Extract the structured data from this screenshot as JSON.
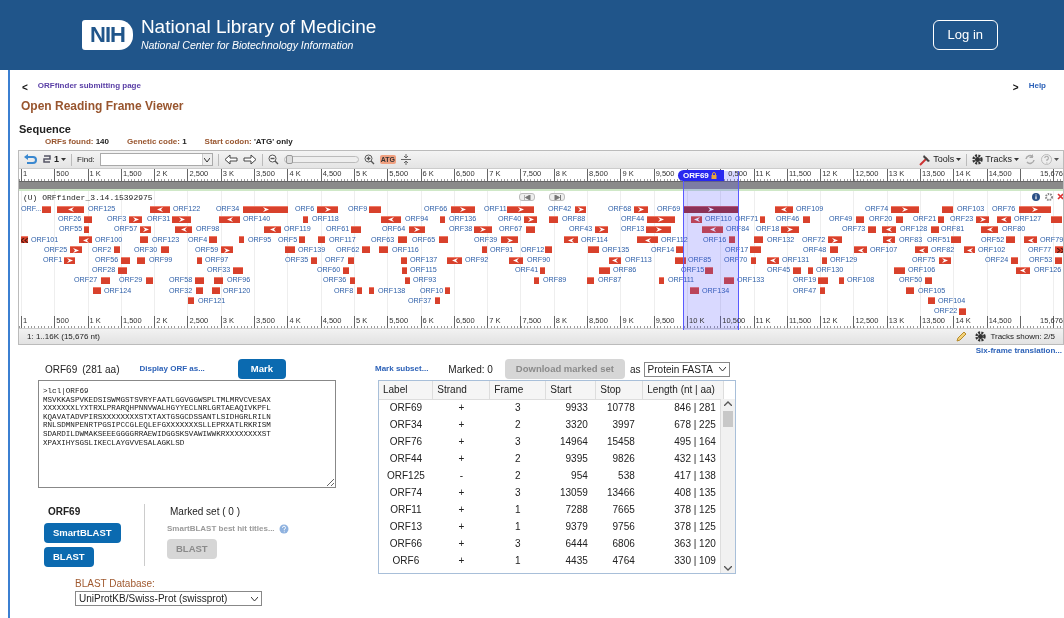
{
  "header": {
    "logo": "NIH",
    "title": "National Library of Medicine",
    "subtitle": "National Center for Biotechnology Information",
    "login": "Log in"
  },
  "nav": {
    "back_arrow": "<",
    "back_link": "ORFfinder submitting page",
    "help_arrow": ">",
    "help": "Help"
  },
  "heading": "Open Reading Frame Viewer",
  "section": "Sequence",
  "stats": [
    {
      "label": "ORFs found:",
      "value": "140"
    },
    {
      "label": "Genetic code:",
      "value": "1"
    },
    {
      "label": "Start codon:",
      "value": "'ATG' only"
    }
  ],
  "viewer": {
    "toolbar": {
      "layout_count": "1",
      "find_label": "Find:",
      "atg": "ATG",
      "tools": "Tools",
      "tracks": "Tracks"
    },
    "top_ruler": [
      "1",
      "500",
      "1 K",
      "1,500",
      "2 K",
      "2,500",
      "3 K",
      "3,500",
      "4 K",
      "4,500",
      "5 K",
      "5,500",
      "6 K",
      "6,500",
      "7 K",
      "7,500",
      "8 K",
      "8,500",
      "9 K",
      "9,500",
      "0,500",
      "11 K",
      "11,500",
      "12 K",
      "12,500",
      "13 K",
      "13,500",
      "14 K",
      "14,500",
      "15,676"
    ],
    "marker": "ORF69",
    "track_title": "(U) ORFfinder_3.14.15392975",
    "lanes": [
      {
        "features": [
          {
            "label": "ORF...",
            "kind": "plain",
            "selected": false
          },
          {
            "label": "ORF125",
            "kind": "left",
            "selected": false
          },
          {
            "label": "ORF122",
            "kind": "left",
            "selected": false
          },
          {
            "label": "ORF34",
            "kind": "right",
            "selected": false
          },
          {
            "label": "ORF6",
            "kind": "right",
            "selected": false
          },
          {
            "label": "ORF9",
            "kind": "plain",
            "selected": false
          },
          {
            "label": "ORF66",
            "kind": "right",
            "selected": false
          },
          {
            "label": "ORF11",
            "kind": "right",
            "selected": false
          },
          {
            "label": "ORF42",
            "kind": "right",
            "selected": false
          },
          {
            "label": "ORF68",
            "kind": "right",
            "selected": false
          },
          {
            "label": "ORF69",
            "kind": "right",
            "selected": true
          },
          {
            "label": "ORF109",
            "kind": "left",
            "selected": false
          },
          {
            "label": "ORF74",
            "kind": "right",
            "selected": false
          },
          {
            "label": "ORF103",
            "kind": "plain",
            "selected": false
          },
          {
            "label": "ORF76",
            "kind": "right",
            "selected": false
          }
        ]
      },
      {
        "features": [
          {
            "label": "ORF26",
            "kind": "plain",
            "selected": false
          },
          {
            "label": "ORF3",
            "kind": "right",
            "selected": false
          },
          {
            "label": "ORF31",
            "kind": "right",
            "selected": false
          },
          {
            "label": "ORF140",
            "kind": "left",
            "selected": false
          },
          {
            "label": "ORF118",
            "kind": "plain",
            "selected": false
          },
          {
            "label": "ORF94",
            "kind": "left",
            "selected": false
          },
          {
            "label": "ORF136",
            "kind": "plain",
            "selected": false
          },
          {
            "label": "ORF40",
            "kind": "right",
            "selected": false
          },
          {
            "label": "ORF88",
            "kind": "plain",
            "selected": false
          },
          {
            "label": "ORF44",
            "kind": "right",
            "selected": false
          },
          {
            "label": "ORF110",
            "kind": "left",
            "selected": false
          },
          {
            "label": "ORF71",
            "kind": "plain",
            "selected": false
          },
          {
            "label": "ORF46",
            "kind": "plain",
            "selected": false
          },
          {
            "label": "ORF49",
            "kind": "plain",
            "selected": false
          },
          {
            "label": "ORF20",
            "kind": "plain",
            "selected": false
          },
          {
            "label": "ORF21",
            "kind": "plain",
            "selected": false
          },
          {
            "label": "ORF23",
            "kind": "right",
            "selected": false
          },
          {
            "label": "ORF127",
            "kind": "left",
            "selected": false
          },
          {
            "kind": "plain",
            "selected": false
          }
        ]
      },
      {
        "features": [
          {
            "label": "ORF55",
            "kind": "plain",
            "selected": false
          },
          {
            "label": "ORF57",
            "kind": "right",
            "selected": false
          },
          {
            "label": "ORF98",
            "kind": "left",
            "selected": false
          },
          {
            "label": "ORF119",
            "kind": "left",
            "selected": false
          },
          {
            "label": "ORF61",
            "kind": "plain",
            "selected": false
          },
          {
            "label": "ORF64",
            "kind": "right",
            "selected": false
          },
          {
            "label": "ORF38",
            "kind": "right",
            "selected": false
          },
          {
            "label": "ORF67",
            "kind": "plain",
            "selected": false
          },
          {
            "label": "ORF43",
            "kind": "right",
            "selected": false
          },
          {
            "label": "ORF13",
            "kind": "right",
            "selected": false
          },
          {
            "label": "ORF84",
            "kind": "left",
            "selected": false
          },
          {
            "label": "ORF18",
            "kind": "right",
            "selected": false
          },
          {
            "label": "ORF73",
            "kind": "plain",
            "selected": false
          },
          {
            "label": "ORF128",
            "kind": "left",
            "selected": false
          },
          {
            "label": "ORF81",
            "kind": "plain",
            "selected": false
          },
          {
            "label": "ORF80",
            "kind": "left",
            "selected": false
          }
        ]
      },
      {
        "features": [
          {
            "label": "ORF101",
            "kind": "edge-left",
            "selected": false
          },
          {
            "label": "ORF100",
            "kind": "left",
            "selected": false
          },
          {
            "label": "ORF123",
            "kind": "plain",
            "selected": false
          },
          {
            "label": "ORF4",
            "kind": "plain",
            "selected": false
          },
          {
            "label": "ORF95",
            "kind": "plain",
            "selected": false
          },
          {
            "label": "ORF5",
            "kind": "plain",
            "selected": false
          },
          {
            "label": "ORF117",
            "kind": "plain",
            "selected": false
          },
          {
            "label": "ORF63",
            "kind": "plain",
            "selected": false
          },
          {
            "label": "ORF65",
            "kind": "plain",
            "selected": false
          },
          {
            "label": "ORF39",
            "kind": "right",
            "selected": false
          },
          {
            "label": "ORF114",
            "kind": "left",
            "selected": false
          },
          {
            "label": "ORF112",
            "kind": "left",
            "selected": false
          },
          {
            "label": "ORF16",
            "kind": "plain",
            "selected": false
          },
          {
            "label": "ORF132",
            "kind": "plain",
            "selected": false
          },
          {
            "label": "ORF72",
            "kind": "right",
            "selected": false
          },
          {
            "label": "ORF83",
            "kind": "left",
            "selected": false
          },
          {
            "label": "ORF51",
            "kind": "plain",
            "selected": false
          },
          {
            "label": "ORF52",
            "kind": "plain",
            "selected": false
          },
          {
            "label": "ORF79",
            "kind": "left",
            "selected": false
          }
        ]
      },
      {
        "features": [
          {
            "label": "ORF25",
            "kind": "right",
            "selected": false
          },
          {
            "label": "ORF2",
            "kind": "plain",
            "selected": false
          },
          {
            "label": "ORF30",
            "kind": "plain",
            "selected": false
          },
          {
            "label": "ORF59",
            "kind": "right",
            "selected": false
          },
          {
            "label": "ORF139",
            "kind": "plain",
            "selected": false
          },
          {
            "label": "ORF62",
            "kind": "plain",
            "selected": false
          },
          {
            "label": "ORF116",
            "kind": "plain",
            "selected": false
          },
          {
            "label": "ORF91",
            "kind": "plain",
            "selected": false
          },
          {
            "label": "ORF12",
            "kind": "plain",
            "selected": false
          },
          {
            "label": "ORF135",
            "kind": "plain",
            "selected": false
          },
          {
            "label": "ORF14",
            "kind": "plain",
            "selected": false
          },
          {
            "label": "ORF17",
            "kind": "plain",
            "selected": false
          },
          {
            "label": "ORF48",
            "kind": "plain",
            "selected": false
          },
          {
            "label": "ORF107",
            "kind": "left",
            "selected": false
          },
          {
            "label": "ORF82",
            "kind": "left",
            "selected": false
          },
          {
            "label": "ORF102",
            "kind": "left",
            "selected": false
          },
          {
            "label": "ORF77",
            "kind": "edge-right",
            "selected": false
          }
        ]
      },
      {
        "features": [
          {
            "label": "ORF1",
            "kind": "right",
            "selected": false
          },
          {
            "label": "ORF56",
            "kind": "plain",
            "selected": false
          },
          {
            "label": "ORF99",
            "kind": "plain",
            "selected": false
          },
          {
            "label": "ORF97",
            "kind": "plain",
            "selected": false
          },
          {
            "label": "ORF35",
            "kind": "plain",
            "selected": false
          },
          {
            "label": "ORF7",
            "kind": "plain",
            "selected": false
          },
          {
            "label": "ORF137",
            "kind": "plain",
            "selected": false
          },
          {
            "label": "ORF92",
            "kind": "left",
            "selected": false
          },
          {
            "label": "ORF90",
            "kind": "left",
            "selected": false
          },
          {
            "label": "ORF113",
            "kind": "left",
            "selected": false
          },
          {
            "label": "ORF85",
            "kind": "plain",
            "selected": false
          },
          {
            "label": "ORF70",
            "kind": "plain",
            "selected": false
          },
          {
            "label": "ORF131",
            "kind": "left",
            "selected": false
          },
          {
            "label": "ORF129",
            "kind": "plain",
            "selected": false
          },
          {
            "label": "ORF75",
            "kind": "right",
            "selected": false
          },
          {
            "label": "ORF24",
            "kind": "plain",
            "selected": false
          },
          {
            "label": "ORF53",
            "kind": "plain",
            "selected": false
          }
        ]
      },
      {
        "features": [
          {
            "label": "ORF28",
            "kind": "plain",
            "selected": false
          },
          {
            "label": "ORF33",
            "kind": "plain",
            "selected": false
          },
          {
            "label": "ORF60",
            "kind": "plain",
            "selected": false
          },
          {
            "label": "ORF115",
            "kind": "plain",
            "selected": false
          },
          {
            "label": "ORF41",
            "kind": "plain",
            "selected": false
          },
          {
            "label": "ORF86",
            "kind": "plain",
            "selected": false
          },
          {
            "label": "ORF15",
            "kind": "plain",
            "selected": false
          },
          {
            "label": "ORF45",
            "kind": "plain",
            "selected": false
          },
          {
            "label": "ORF130",
            "kind": "plain",
            "selected": false
          },
          {
            "label": "ORF106",
            "kind": "plain",
            "selected": false
          },
          {
            "label": "ORF126",
            "kind": "left",
            "selected": false
          }
        ]
      },
      {
        "features": [
          {
            "label": "ORF27",
            "kind": "plain",
            "selected": false
          },
          {
            "label": "ORF29",
            "kind": "plain",
            "selected": false
          },
          {
            "label": "ORF58",
            "kind": "plain",
            "selected": false
          },
          {
            "label": "ORF96",
            "kind": "plain",
            "selected": false
          },
          {
            "label": "ORF36",
            "kind": "plain",
            "selected": false
          },
          {
            "label": "ORF93",
            "kind": "plain",
            "selected": false
          },
          {
            "label": "ORF89",
            "kind": "plain",
            "selected": false
          },
          {
            "label": "ORF87",
            "kind": "plain",
            "selected": false
          },
          {
            "label": "ORF111",
            "kind": "plain",
            "selected": false
          },
          {
            "label": "ORF133",
            "kind": "plain",
            "selected": false
          },
          {
            "label": "ORF19",
            "kind": "plain",
            "selected": false
          },
          {
            "label": "ORF108",
            "kind": "plain",
            "selected": false
          },
          {
            "label": "ORF50",
            "kind": "plain",
            "selected": false
          }
        ]
      },
      {
        "features": [
          {
            "label": "ORF124",
            "kind": "plain",
            "selected": false
          },
          {
            "label": "ORF32",
            "kind": "plain",
            "selected": false
          },
          {
            "label": "ORF120",
            "kind": "plain",
            "selected": false
          },
          {
            "label": "ORF8",
            "kind": "plain",
            "selected": false
          },
          {
            "label": "ORF138",
            "kind": "plain",
            "selected": false
          },
          {
            "label": "ORF10",
            "kind": "plain",
            "selected": false
          },
          {
            "label": "ORF134",
            "kind": "plain",
            "selected": false
          },
          {
            "label": "ORF47",
            "kind": "plain",
            "selected": false
          },
          {
            "label": "ORF105",
            "kind": "plain",
            "selected": false
          }
        ]
      },
      {
        "features": [
          {
            "label": "ORF121",
            "kind": "plain",
            "selected": false
          },
          {
            "label": "ORF37",
            "kind": "plain",
            "selected": false
          },
          {
            "label": "ORF104",
            "kind": "plain",
            "selected": false
          }
        ]
      },
      {
        "features": [
          {
            "label": "ORF22",
            "kind": "plain",
            "selected": false
          }
        ]
      }
    ],
    "bottom_ruler": [
      "1",
      "500",
      "1 K",
      "1,500",
      "2 K",
      "2,500",
      "3 K",
      "3,500",
      "4 K",
      "4,500",
      "5 K",
      "5,500",
      "6 K",
      "6,500",
      "7 K",
      "7,500",
      "8 K",
      "8,500",
      "9 K",
      "9,500",
      "10 K",
      "10,500",
      "11 K",
      "11,500",
      "12 K",
      "12,500",
      "13 K",
      "13,500",
      "14 K",
      "14,500",
      "15,676"
    ],
    "range": "1: 1..16K (15,676 nt)",
    "tracks_shown": "Tracks shown: 2/5"
  },
  "six_frame": "Six-frame translation...",
  "orf_panel": {
    "name": "ORF69",
    "length": "(281 aa)",
    "display_link": "Display ORF as...",
    "mark": "Mark",
    "sequence": ">lcl|ORF69\nMSVKKASPVKEDSISWMGSTSVRYFAATLGGVGGWSPLTMLMRVCVESAX\nXXXXXXXLYXTRXLPRARQHPNNVWALHGYYECLNRLGRTAEAQIVKPFL\nKQAVATADVPIRSXXXXXXXXSTXTAXTGSGCDSSANTLSIDHGRLRILN\nRNLSDMNPENRTPGSIPCCGLEQLEFGXXXXXXXSLLEPRXATLRKRISM\nSDARDILDWMAKSEEEGGGGRRAEWIDGGSKSVAWIWWKRXXXXXXXXST\nXPAXIHYSGSLIKECLAYGVVESALAGKLSD",
    "blast_title": "ORF69",
    "smartblast": "SmartBLAST",
    "blast": "BLAST",
    "marked_title": "Marked set ( 0 )",
    "hit_titles": "SmartBLAST best hit titles...",
    "marked_blast": "BLAST",
    "marked_blast_disabled": true,
    "db_label": "BLAST Database:",
    "db_value": "UniProtKB/Swiss-Prot (swissprot)"
  },
  "orf_list": {
    "mark_subset": "Mark subset...",
    "marked": "Marked: 0",
    "download": "Download marked set",
    "download_disabled": true,
    "as": "as",
    "format": "Protein FASTA",
    "columns": [
      "Label",
      "Strand",
      "Frame",
      "Start",
      "Stop",
      "Length (nt | aa)"
    ],
    "rows": [
      [
        "ORF69",
        "+",
        "3",
        "9933",
        "10778",
        "846 | 281"
      ],
      [
        "ORF34",
        "+",
        "2",
        "3320",
        "3997",
        "678 | 225"
      ],
      [
        "ORF76",
        "+",
        "3",
        "14964",
        "15458",
        "495 | 164"
      ],
      [
        "ORF44",
        "+",
        "2",
        "9395",
        "9826",
        "432 | 143"
      ],
      [
        "ORF125",
        "-",
        "2",
        "954",
        "538",
        "417 | 138"
      ],
      [
        "ORF74",
        "+",
        "3",
        "13059",
        "13466",
        "408 | 135"
      ],
      [
        "ORF11",
        "+",
        "1",
        "7288",
        "7665",
        "378 | 125"
      ],
      [
        "ORF13",
        "+",
        "1",
        "9379",
        "9756",
        "378 | 125"
      ],
      [
        "ORF66",
        "+",
        "3",
        "6444",
        "6806",
        "363 | 120"
      ],
      [
        "ORF6",
        "+",
        "1",
        "4435",
        "4764",
        "330 | 109"
      ]
    ]
  }
}
